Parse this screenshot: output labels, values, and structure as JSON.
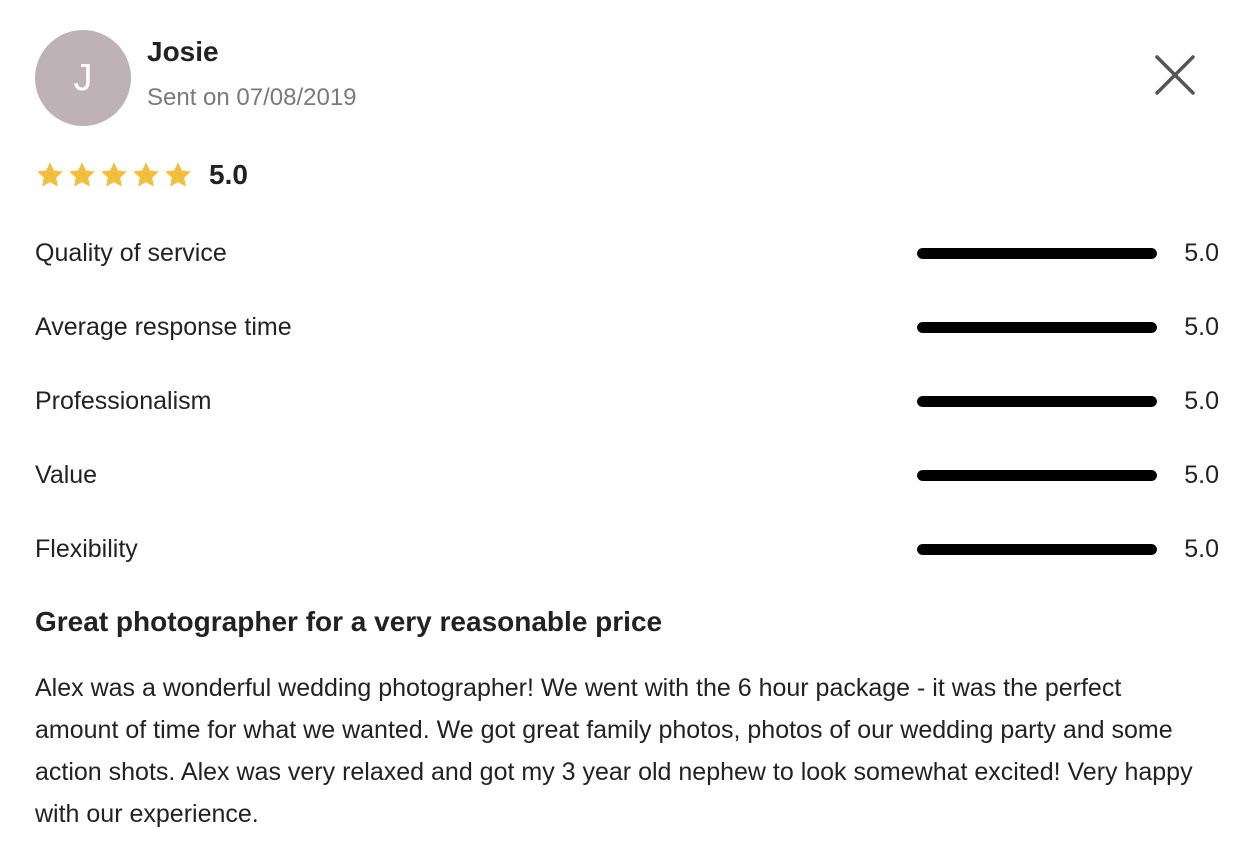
{
  "reviewer": {
    "initial": "J",
    "name": "Josie",
    "sent": "Sent on 07/08/2019",
    "avatar_color": "#beb2b7"
  },
  "close_icon": "close-icon",
  "overall": {
    "stars": 5,
    "star_color": "#f3bd3f",
    "value": "5.0"
  },
  "ratings": [
    {
      "label": "Quality of service",
      "value": "5.0",
      "fill": 1.0
    },
    {
      "label": "Average response time",
      "value": "5.0",
      "fill": 1.0
    },
    {
      "label": "Professionalism",
      "value": "5.0",
      "fill": 1.0
    },
    {
      "label": "Value",
      "value": "5.0",
      "fill": 1.0
    },
    {
      "label": "Flexibility",
      "value": "5.0",
      "fill": 1.0
    }
  ],
  "review": {
    "title": "Great photographer for a very reasonable price",
    "body": "Alex was a wonderful wedding photographer! We went with the 6 hour package - it was the perfect amount of time for what we wanted. We got great family photos, photos of our wedding party and some action shots. Alex was very relaxed and got my 3 year old nephew to look somewhat excited! Very happy with our experience."
  }
}
